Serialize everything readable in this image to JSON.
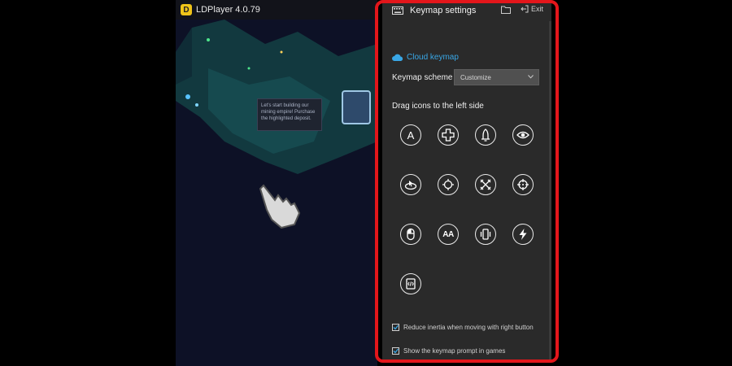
{
  "emulator": {
    "title": "LDPlayer 4.0.79",
    "logo": "D",
    "tooltip": "Let's start building our mining empire! Purchase the highlighted deposit."
  },
  "panel": {
    "title": "Keymap settings",
    "exit_label": "Exit",
    "cloud_keymap": "Cloud keymap",
    "scheme_label": "Keymap scheme",
    "scheme_value": "Customize",
    "drag_label": "Drag icons to the left side",
    "tools": [
      {
        "icon": "letter-a-icon",
        "text": "A"
      },
      {
        "icon": "dpad-icon"
      },
      {
        "icon": "rocket-icon"
      },
      {
        "icon": "eye-icon"
      },
      {
        "icon": "aim-cursor-icon"
      },
      {
        "icon": "rotate-icon"
      },
      {
        "icon": "crossed-swords-icon"
      },
      {
        "icon": "crosshair-icon"
      },
      {
        "icon": "mouse-icon"
      },
      {
        "icon": "letters-aa-icon",
        "text": "AA"
      },
      {
        "icon": "phone-shake-icon"
      },
      {
        "icon": "lightning-icon"
      },
      {
        "icon": "script-icon"
      }
    ],
    "options": [
      {
        "label": "Reduce inertia when moving with right button",
        "checked": true
      },
      {
        "label": "Show the keymap prompt in games",
        "checked": true
      }
    ]
  },
  "colors": {
    "accent": "#39a7e6",
    "highlight_border": "#e3161b",
    "panel_bg": "#2a2a2a"
  }
}
